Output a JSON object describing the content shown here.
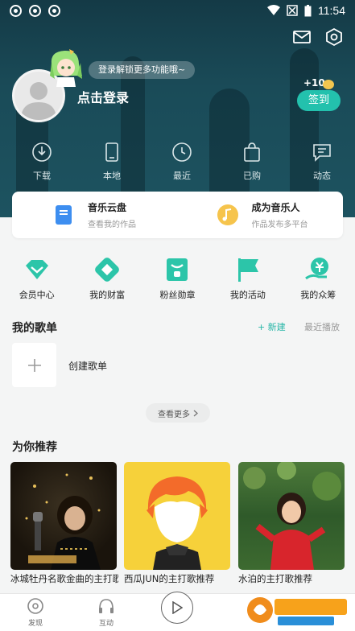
{
  "status_bar": {
    "time": "11:54"
  },
  "header": {
    "login_tip": "登录解锁更多功能哦~",
    "login_label": "点击登录",
    "sign_bonus": "+10",
    "sign_in_button": "签到"
  },
  "quick_links": [
    {
      "label": "下载",
      "icon": "download-icon"
    },
    {
      "label": "本地",
      "icon": "phone-icon"
    },
    {
      "label": "最近",
      "icon": "clock-icon"
    },
    {
      "label": "已购",
      "icon": "bag-icon"
    },
    {
      "label": "动态",
      "icon": "chat-icon"
    }
  ],
  "cloud_card": {
    "left": {
      "title": "音乐云盘",
      "subtitle": "查看我的作品",
      "icon": "cloud-disk-icon"
    },
    "right": {
      "title": "成为音乐人",
      "subtitle": "作品发布多平台",
      "icon": "music-note-icon"
    }
  },
  "features": [
    {
      "label": "会员中心",
      "icon": "diamond-icon"
    },
    {
      "label": "我的财富",
      "icon": "wealth-icon"
    },
    {
      "label": "粉丝勋章",
      "icon": "medal-icon"
    },
    {
      "label": "我的活动",
      "icon": "flag-icon"
    },
    {
      "label": "我的众筹",
      "icon": "crowdfund-icon"
    }
  ],
  "playlist": {
    "title": "我的歌单",
    "new_label": "+ 新建",
    "recent_label": "最近播放",
    "create_label": "创建歌单",
    "more_label": "查看更多"
  },
  "recommend": {
    "title": "为你推荐",
    "cards": [
      {
        "caption": "冰城牡丹名歌金曲的主打歌推荐"
      },
      {
        "caption": "西瓜JUN的主打歌推荐"
      },
      {
        "caption": "水泊的主打歌推荐"
      }
    ]
  },
  "bottom_nav": [
    {
      "label": "发现",
      "icon": "discover-icon"
    },
    {
      "label": "互动",
      "icon": "headphones-icon"
    },
    {
      "label": "",
      "icon": "play-icon"
    }
  ],
  "colors": {
    "accent": "#26b6a7",
    "header": "#1a4b58",
    "signin": "#23c1ad"
  }
}
